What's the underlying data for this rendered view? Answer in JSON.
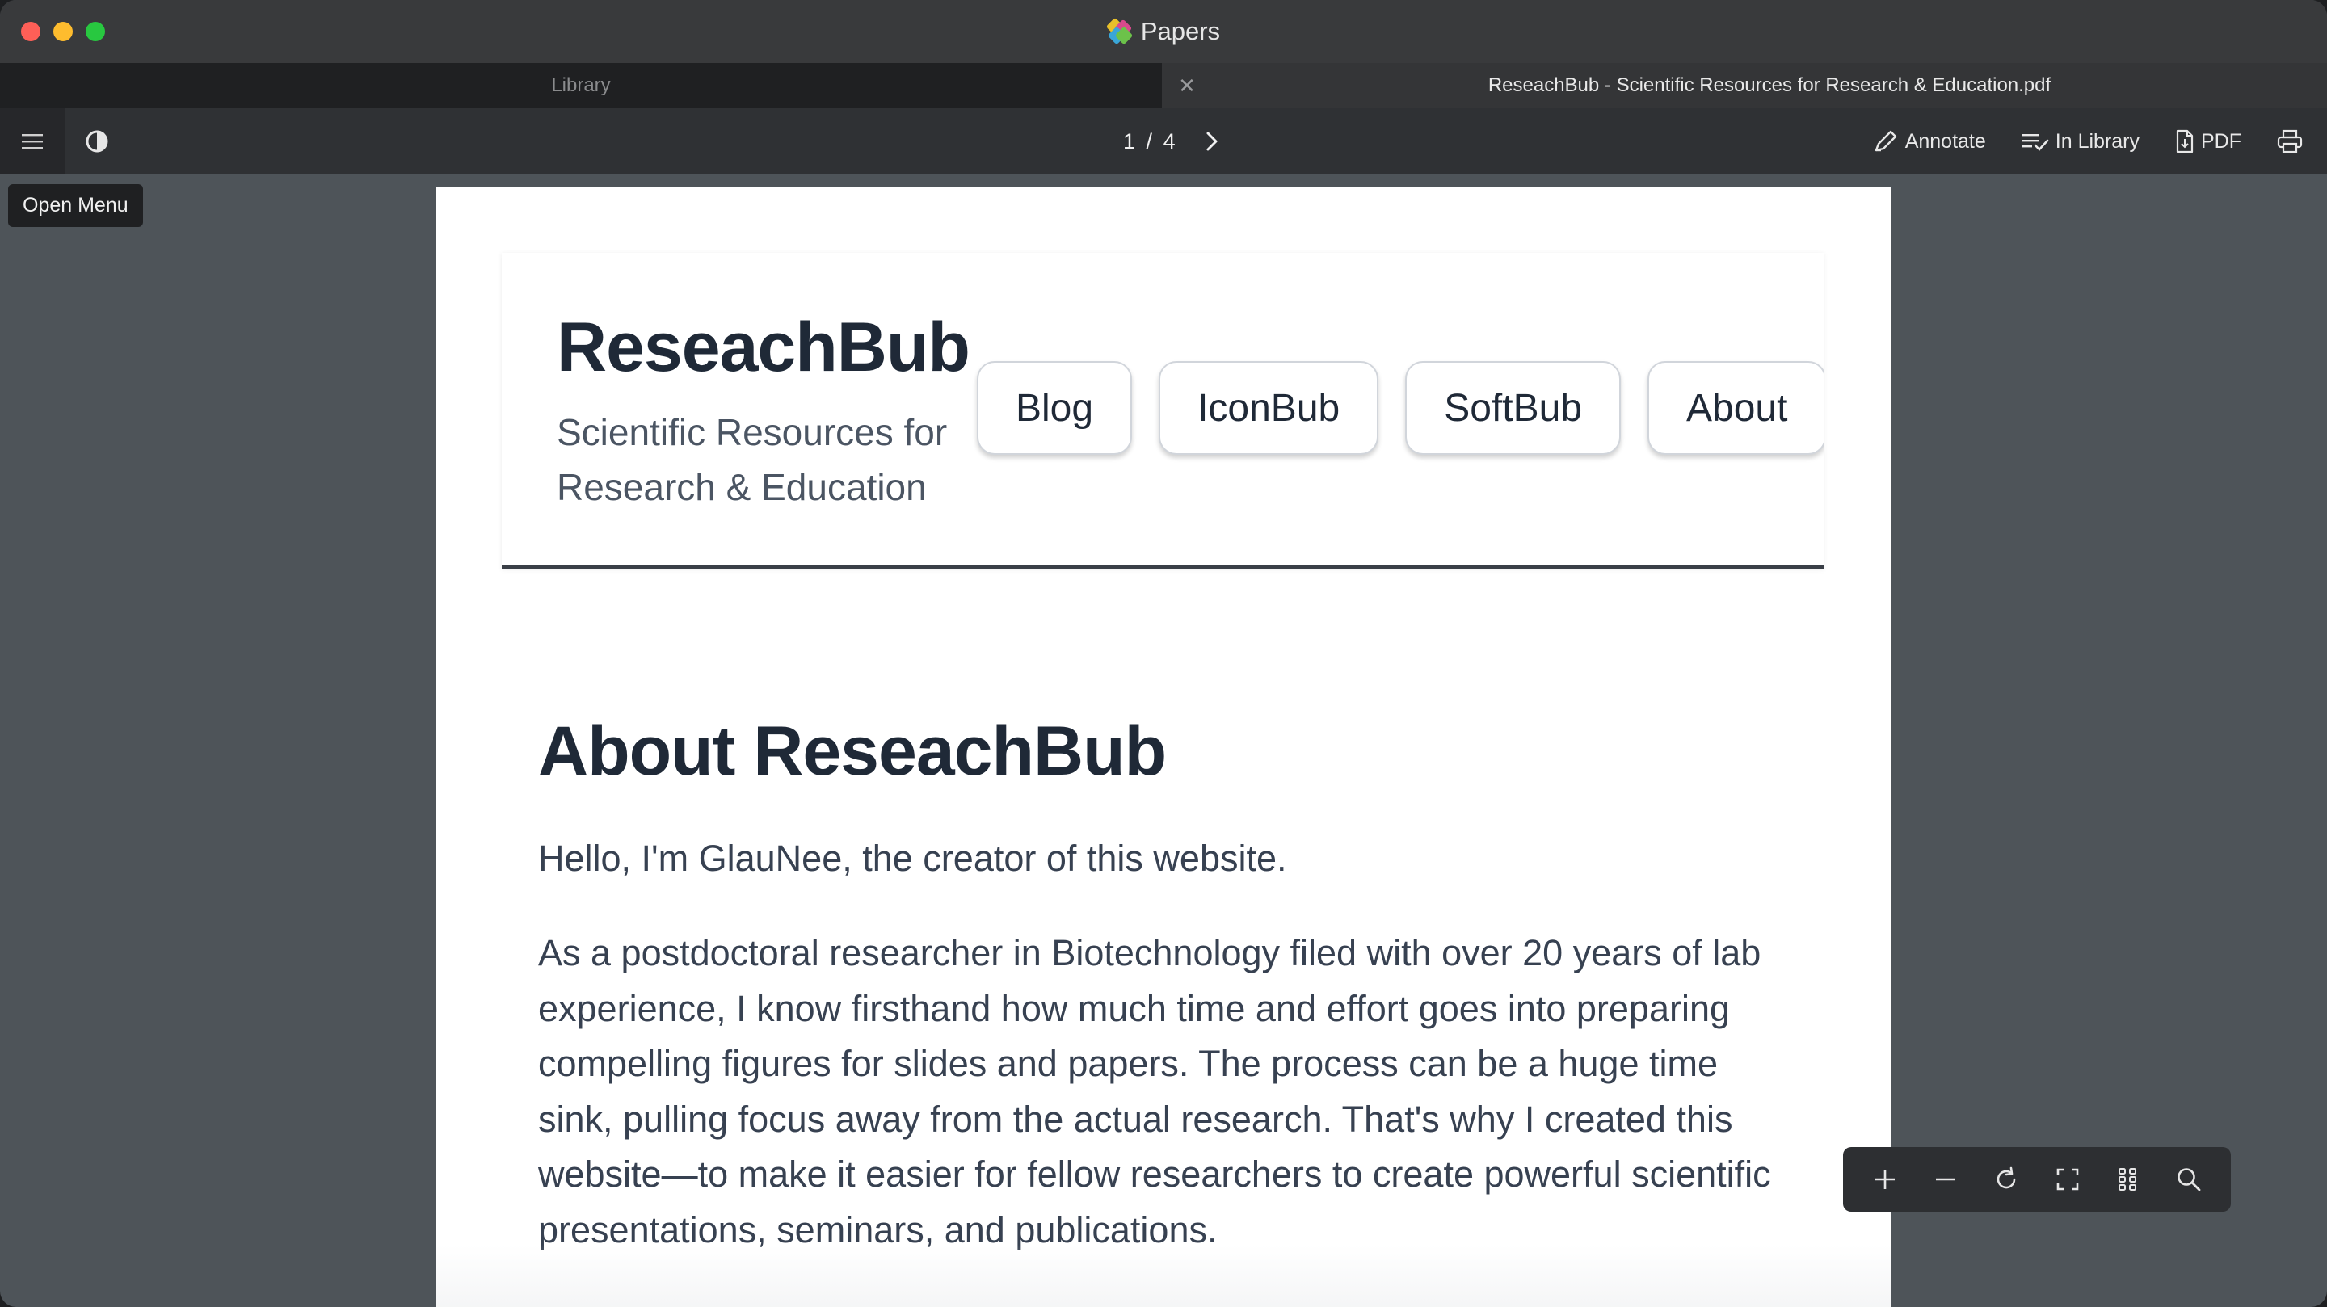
{
  "window": {
    "title": "Papers"
  },
  "tabs": [
    {
      "label": "Library"
    },
    {
      "label": "ReseachBub - Scientific Resources for Research & Education.pdf"
    }
  ],
  "toolbar": {
    "page_current": "1",
    "page_sep": "/",
    "page_total": "4",
    "annotate_label": "Annotate",
    "in_library_label": "In Library",
    "pdf_label": "PDF"
  },
  "tooltip": {
    "text": "Open Menu"
  },
  "document": {
    "site_title": "ReseachBub",
    "site_subtitle": "Scientific Resources for Research & Education",
    "nav": [
      "Blog",
      "IconBub",
      "SoftBub",
      "About"
    ],
    "heading": "About ReseachBub",
    "intro": "Hello, I'm GlauNee, the creator of this website.",
    "body": "As a postdoctoral researcher in Biotechnology filed with over 20 years of lab experience, I know firsthand how much time and effort goes into preparing compelling figures for slides and papers. The process can be a huge time sink, pulling focus away from the actual research. That's why I created this website—to make it easier for fellow researchers to create powerful scientific presentations, seminars, and publications."
  },
  "icons": {
    "menu": "hamburger-icon",
    "theme": "contrast-icon",
    "next": "chevron-right-icon",
    "annotate": "pen-icon",
    "in_library": "list-check-icon",
    "pdf": "document-icon",
    "print": "printer-icon",
    "zoom_in": "plus-icon",
    "zoom_out": "minus-icon",
    "rotate": "rotate-icon",
    "fit": "fullscreen-icon",
    "thumbnails": "grid-icon",
    "search": "search-icon"
  },
  "colors": {
    "titlebar": "#393a3c",
    "toolbar": "#2f3134",
    "canvas": "#4e5459",
    "page": "#ffffff",
    "text_dark": "#1f2937"
  }
}
